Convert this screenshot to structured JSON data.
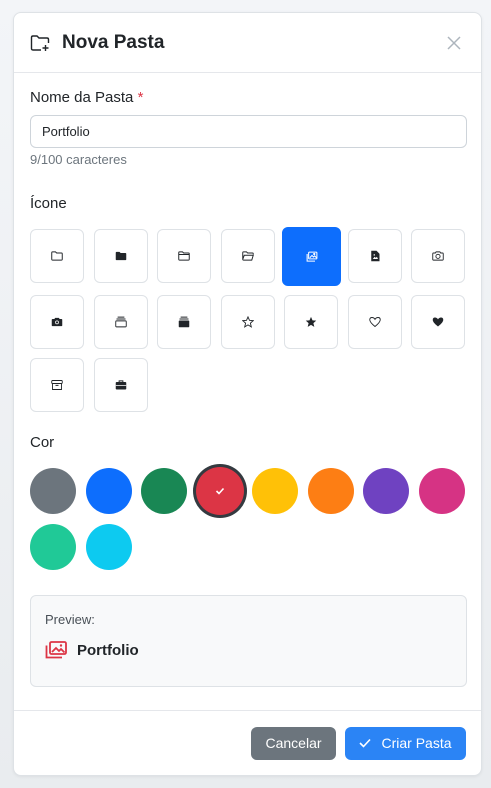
{
  "modal": {
    "title": "Nova Pasta",
    "title_icon": "folder-plus-icon",
    "close_icon": "close-icon"
  },
  "name_field": {
    "label": "Nome da Pasta",
    "required_mark": "*",
    "value": "Portfolio",
    "counter": "9/100 caracteres"
  },
  "icon_section": {
    "label": "Ícone",
    "icons": [
      {
        "name": "folder-icon",
        "selected": false
      },
      {
        "name": "folder-fill-icon",
        "selected": false
      },
      {
        "name": "folder2-icon",
        "selected": false
      },
      {
        "name": "folder2-open-icon",
        "selected": false
      },
      {
        "name": "images-icon",
        "selected": true
      },
      {
        "name": "file-image-icon",
        "selected": false
      },
      {
        "name": "camera-icon",
        "selected": false
      },
      {
        "name": "camera-fill-icon",
        "selected": false
      },
      {
        "name": "collection-icon",
        "selected": false
      },
      {
        "name": "collection-fill-icon",
        "selected": false
      },
      {
        "name": "star-icon",
        "selected": false
      },
      {
        "name": "star-fill-icon",
        "selected": false
      },
      {
        "name": "heart-icon",
        "selected": false
      },
      {
        "name": "heart-fill-icon",
        "selected": false
      },
      {
        "name": "archive-icon",
        "selected": false
      },
      {
        "name": "briefcase-icon",
        "selected": false
      }
    ]
  },
  "color_section": {
    "label": "Cor",
    "colors": [
      "#6c757d",
      "#0d6efd",
      "#198754",
      "#dc3545",
      "#ffc107",
      "#fd7e14",
      "#6f42c1",
      "#d63384",
      "#20c997",
      "#0dcaf0"
    ],
    "selected_index": 3
  },
  "preview": {
    "label": "Preview:",
    "name": "Portfolio",
    "icon": "images-icon",
    "icon_color": "#dc3545"
  },
  "footer": {
    "cancel_label": "Cancelar",
    "create_label": "Criar Pasta",
    "create_icon": "check-icon"
  }
}
